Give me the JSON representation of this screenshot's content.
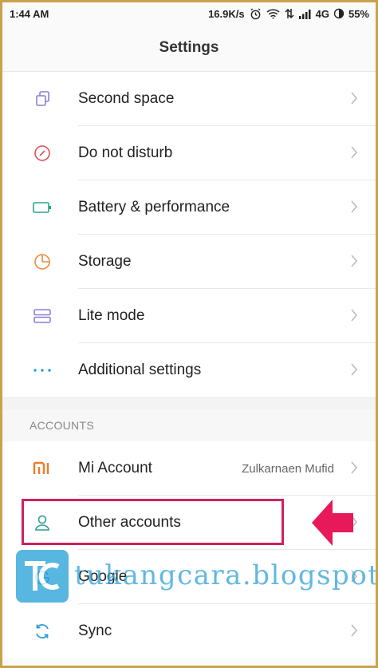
{
  "status": {
    "time": "1:44 AM",
    "speed": "16.9K/s",
    "network": "4G",
    "battery": "55%"
  },
  "appbar": {
    "title": "Settings"
  },
  "items_top": [
    {
      "label": "Second space",
      "icon": "second-space-icon"
    },
    {
      "label": "Do not disturb",
      "icon": "do-not-disturb-icon"
    },
    {
      "label": "Battery & performance",
      "icon": "battery-icon"
    },
    {
      "label": "Storage",
      "icon": "storage-icon"
    },
    {
      "label": "Lite mode",
      "icon": "lite-mode-icon"
    },
    {
      "label": "Additional settings",
      "icon": "more-dots-icon"
    }
  ],
  "accounts": {
    "header": "ACCOUNTS",
    "items": [
      {
        "label": "Mi Account",
        "value": "Zulkarnaen Mufid",
        "icon_text": "MI"
      },
      {
        "label": "Other accounts"
      },
      {
        "label": "Google"
      },
      {
        "label": "Sync"
      }
    ]
  },
  "watermark": {
    "logo_text": "TC",
    "text": "tukangcara.blogspot.com"
  },
  "colors": {
    "highlight": "#d0215a",
    "mi_orange": "#f07b24",
    "teal": "#2a9e8e",
    "watermark": "#2aa3d8"
  }
}
